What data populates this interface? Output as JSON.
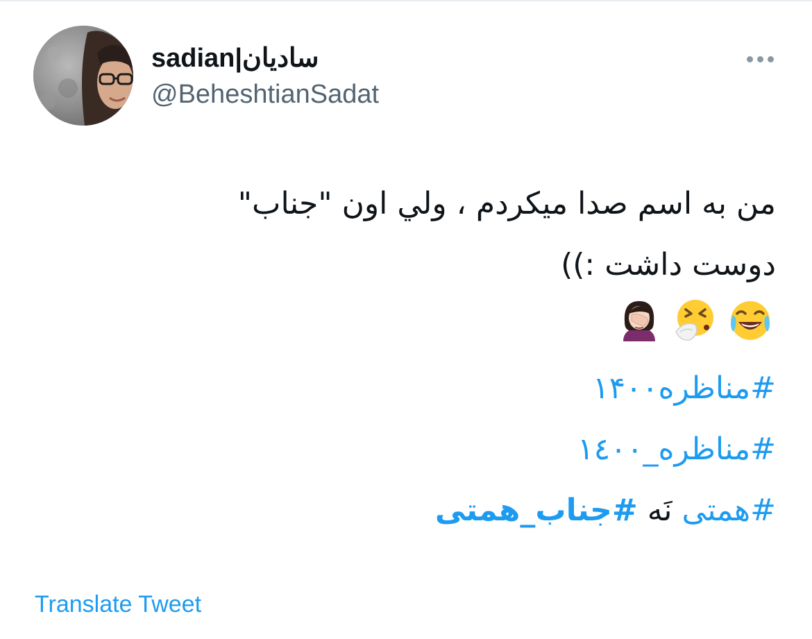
{
  "author": {
    "display_name": "sadian|سادیان",
    "handle": "@BeheshtianSadat"
  },
  "more_icon": "more-horizontal-icon",
  "tweet": {
    "line1": "من به اسم صدا میکردم ، ولي اون \"جناب\"",
    "line2": "دوست داشت :))",
    "emojis": [
      "face-with-tears-of-joy",
      "sneezing-face",
      "woman-facepalming"
    ],
    "hashtag1": "#مناظره۱۴۰۰",
    "hashtag2": "#مناظره_١٤٠٠",
    "line_last_hashtag": "#همتی",
    "line_last_word": "نَه",
    "line_last_bold_hashtag": "#جناب_همتی"
  },
  "translate_label": "Translate Tweet",
  "colors": {
    "link": "#1d9bf0",
    "text": "#0f1419",
    "secondary": "#536471"
  }
}
